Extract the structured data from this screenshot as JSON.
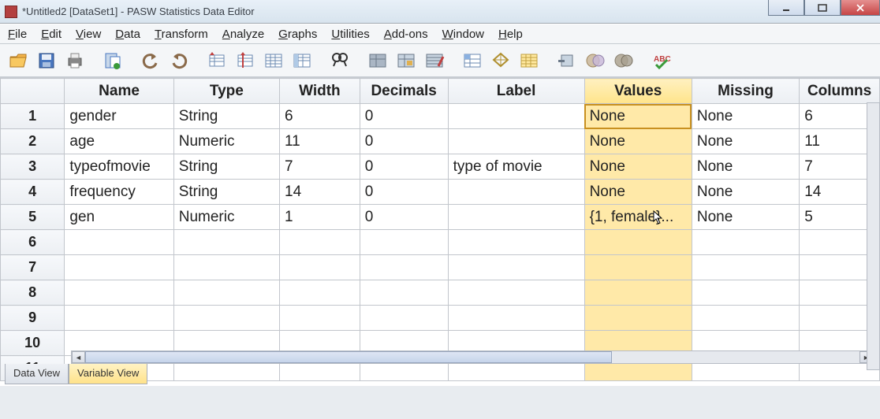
{
  "window": {
    "title": "*Untitled2 [DataSet1] - PASW Statistics Data Editor"
  },
  "menus": [
    "File",
    "Edit",
    "View",
    "Data",
    "Transform",
    "Analyze",
    "Graphs",
    "Utilities",
    "Add-ons",
    "Window",
    "Help"
  ],
  "columns": [
    "Name",
    "Type",
    "Width",
    "Decimals",
    "Label",
    "Values",
    "Missing",
    "Columns"
  ],
  "selectedColumn": "Values",
  "rows": [
    {
      "n": "1",
      "name": "gender",
      "type": "String",
      "width": "6",
      "decimals": "0",
      "label": "",
      "values": "None",
      "missing": "None",
      "cols": "6",
      "sel": true
    },
    {
      "n": "2",
      "name": "age",
      "type": "Numeric",
      "width": "11",
      "decimals": "0",
      "label": "",
      "values": "None",
      "missing": "None",
      "cols": "11"
    },
    {
      "n": "3",
      "name": "typeofmovie",
      "type": "String",
      "width": "7",
      "decimals": "0",
      "label": "type of movie",
      "values": "None",
      "missing": "None",
      "cols": "7"
    },
    {
      "n": "4",
      "name": "frequency",
      "type": "String",
      "width": "14",
      "decimals": "0",
      "label": "",
      "values": "None",
      "missing": "None",
      "cols": "14"
    },
    {
      "n": "5",
      "name": "gen",
      "type": "Numeric",
      "width": "1",
      "decimals": "0",
      "label": "",
      "values": "{1, female}...",
      "missing": "None",
      "cols": "5"
    }
  ],
  "emptyRows": [
    "6",
    "7",
    "8",
    "9",
    "10",
    "11"
  ],
  "tabs": {
    "data": "Data View",
    "variable": "Variable View",
    "active": "variable"
  }
}
